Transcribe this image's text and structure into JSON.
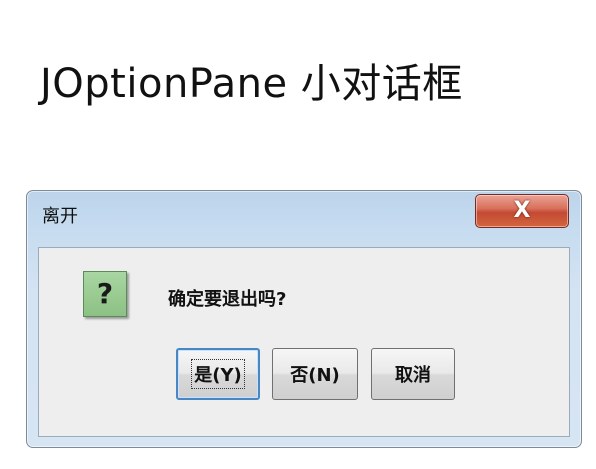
{
  "slide": {
    "title": "JOptionPane 小对话框"
  },
  "dialog": {
    "title": "离开",
    "close_symbol": "X",
    "icon_name": "question-icon",
    "icon_glyph": "?",
    "message": "确定要退出吗?",
    "buttons": {
      "yes_label": "是(Y)",
      "no_label": "否(N)",
      "cancel_label": "取消"
    },
    "colors": {
      "close_button": "#c44a33",
      "question_icon": "#8cc184",
      "focus_border": "#4a86c6"
    }
  }
}
